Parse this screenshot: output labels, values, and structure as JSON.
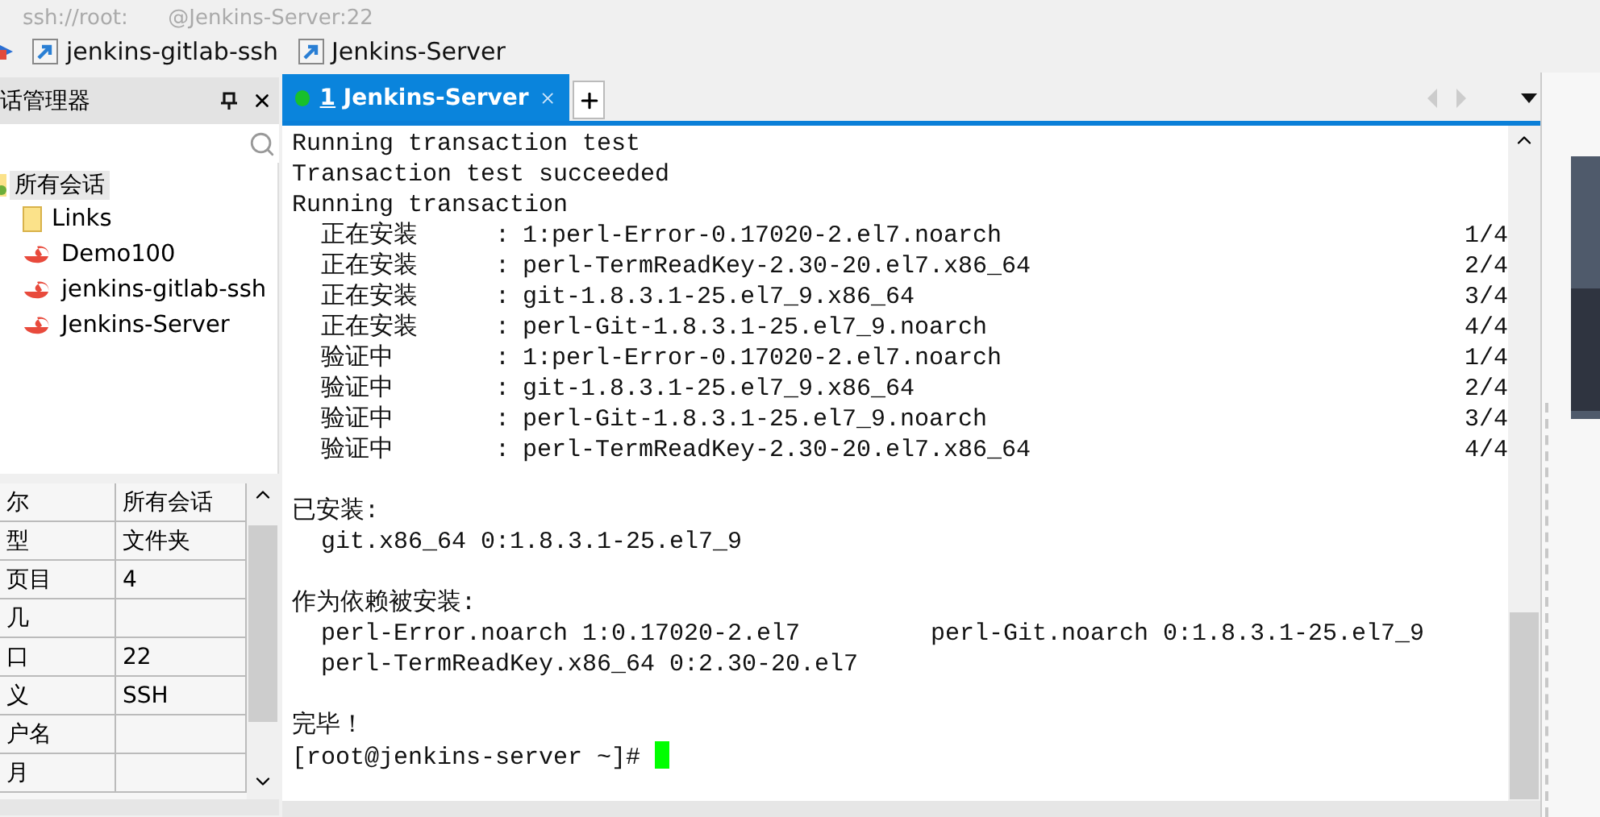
{
  "address_bar": {
    "text": "ssh://root:      @Jenkins-Server:22"
  },
  "links_bar": {
    "items": [
      {
        "label": "jenkins-gitlab-ssh"
      },
      {
        "label": "Jenkins-Server"
      }
    ]
  },
  "session_manager": {
    "title": "话管理器",
    "tree": {
      "label": "所有会话",
      "selected": true,
      "children": [
        {
          "label": "Links",
          "kind": "folder"
        },
        {
          "label": "Demo100",
          "kind": "session"
        },
        {
          "label": "jenkins-gitlab-ssh",
          "kind": "session"
        },
        {
          "label": "Jenkins-Server",
          "kind": "session"
        }
      ]
    },
    "properties": [
      {
        "name": "尔",
        "value": "所有会话"
      },
      {
        "name": "型",
        "value": "文件夹"
      },
      {
        "name": "页目",
        "value": "4"
      },
      {
        "name": "几"
      },
      {
        "name": "口",
        "value": "22"
      },
      {
        "name": "义",
        "value": "SSH"
      },
      {
        "name": "户名"
      },
      {
        "name": "月"
      }
    ]
  },
  "tabs": [
    {
      "number": "1",
      "label": "Jenkins-Server",
      "selected": true,
      "connected": true
    }
  ],
  "terminal": {
    "lines": [
      {
        "kind": "text",
        "text": "Running transaction test"
      },
      {
        "kind": "text",
        "text": "Transaction test succeeded"
      },
      {
        "kind": "text",
        "text": "Running transaction"
      },
      {
        "kind": "step",
        "action": "正在安装",
        "sep": ":",
        "package": "1:perl-Error-0.17020-2.el7.noarch",
        "count": "1/4"
      },
      {
        "kind": "step",
        "action": "正在安装",
        "sep": ":",
        "package": "perl-TermReadKey-2.30-20.el7.x86_64",
        "count": "2/4"
      },
      {
        "kind": "step",
        "action": "正在安装",
        "sep": ":",
        "package": "git-1.8.3.1-25.el7_9.x86_64",
        "count": "3/4"
      },
      {
        "kind": "step",
        "action": "正在安装",
        "sep": ":",
        "package": "perl-Git-1.8.3.1-25.el7_9.noarch",
        "count": "4/4"
      },
      {
        "kind": "step",
        "action": "验证中",
        "sep": ":",
        "package": "1:perl-Error-0.17020-2.el7.noarch",
        "count": "1/4"
      },
      {
        "kind": "step",
        "action": "验证中",
        "sep": ":",
        "package": "git-1.8.3.1-25.el7_9.x86_64",
        "count": "2/4"
      },
      {
        "kind": "step",
        "action": "验证中",
        "sep": ":",
        "package": "perl-Git-1.8.3.1-25.el7_9.noarch",
        "count": "3/4"
      },
      {
        "kind": "step",
        "action": "验证中",
        "sep": ":",
        "package": "perl-TermReadKey-2.30-20.el7.x86_64",
        "count": "4/4"
      },
      {
        "kind": "blank"
      },
      {
        "kind": "text",
        "text": "已安装:"
      },
      {
        "kind": "item",
        "text": "git.x86_64 0:1.8.3.1-25.el7_9"
      },
      {
        "kind": "blank"
      },
      {
        "kind": "text",
        "text": "作为依赖被安装:"
      },
      {
        "kind": "pair",
        "left": "perl-Error.noarch 1:0.17020-2.el7",
        "right": "perl-Git.noarch 0:1.8.3.1-25.el7_9"
      },
      {
        "kind": "item",
        "text": "perl-TermReadKey.x86_64 0:2.30-20.el7"
      },
      {
        "kind": "blank"
      },
      {
        "kind": "text",
        "text": "完毕！"
      },
      {
        "kind": "prompt",
        "text": "[root@jenkins-server ~]#"
      }
    ]
  }
}
